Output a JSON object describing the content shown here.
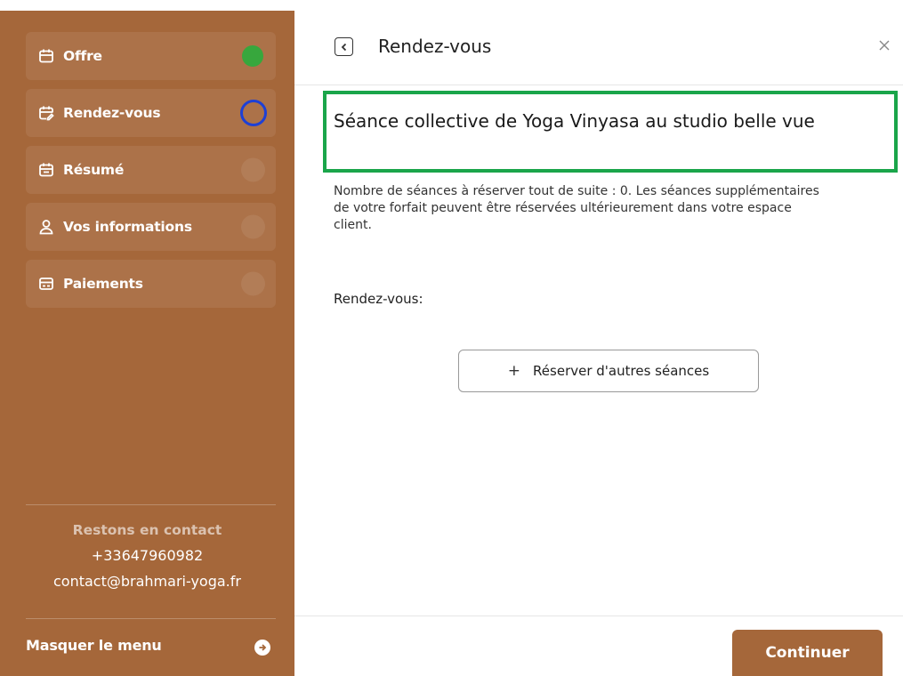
{
  "sidebar": {
    "items": [
      {
        "label": "Offre",
        "icon": "calendar-icon",
        "status": "done"
      },
      {
        "label": "Rendez-vous",
        "icon": "calendar-edit-icon",
        "status": "current"
      },
      {
        "label": "Résumé",
        "icon": "calendar-check-icon",
        "status": "pending"
      },
      {
        "label": "Vos informations",
        "icon": "user-icon",
        "status": "pending"
      },
      {
        "label": "Paiements",
        "icon": "credit-card-icon",
        "status": "pending"
      }
    ],
    "contact": {
      "title": "Restons en contact",
      "phone": "+33647960982",
      "email": "contact@brahmari-yoga.fr"
    },
    "hide_menu_label": "Masquer le menu"
  },
  "header": {
    "title": "Rendez-vous"
  },
  "main": {
    "session_title": "Séance collective de Yoga Vinyasa au studio belle vue",
    "description": "Nombre de séances à réserver tout de suite : 0. Les séances supplémentaires de votre forfait peuvent être réservées ultérieurement dans votre espace client.",
    "appointments_label": "Rendez-vous:",
    "reserve_button_label": "Réserver d'autres séances"
  },
  "footer": {
    "continue_label": "Continuer"
  },
  "colors": {
    "sidebar_bg": "#a5673a",
    "done": "#37a73d",
    "current": "#1d40d6",
    "highlight_border": "#1aa54a"
  }
}
